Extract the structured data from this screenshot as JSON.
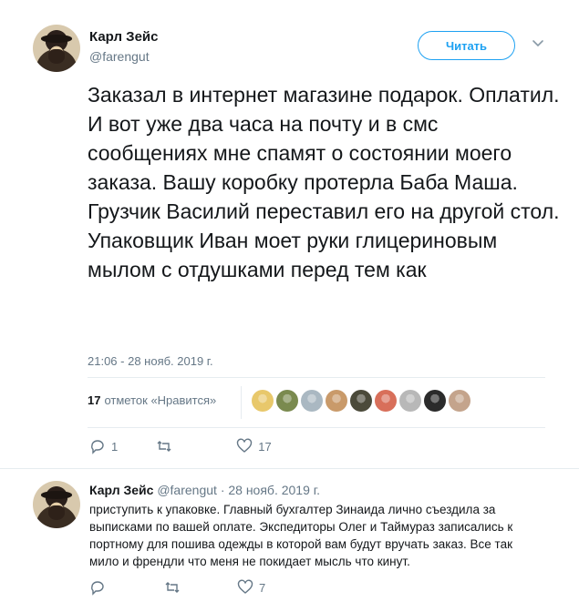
{
  "tweet": {
    "author_name": "Карл Зейс",
    "author_handle": "@farengut",
    "follow_label": "Читать",
    "text": "Заказал в интернет магазине подарок. Оплатил. И вот уже два часа на почту и в смс сообщениях мне спамят о состоянии моего заказа. Вашу коробку протерла Баба Маша. Грузчик Василий переставил его на другой стол. Упаковщик Иван моет руки глицериновым мылом с отдушками перед тем как",
    "timestamp": "21:06 - 28 нояб. 2019 г.",
    "likes_count": "17",
    "likes_label": "отметок «Нравится»",
    "reply_count": "1",
    "retweet_count": "",
    "like_count": "17"
  },
  "likers": [
    {
      "icon": "liker-avatar",
      "color": "#e8c86b"
    },
    {
      "icon": "liker-avatar",
      "color": "#7a8a4f"
    },
    {
      "icon": "liker-avatar",
      "color": "#aab8c2"
    },
    {
      "icon": "liker-avatar",
      "color": "#c99a6a"
    },
    {
      "icon": "liker-avatar",
      "color": "#4b4a3a"
    },
    {
      "icon": "liker-avatar",
      "color": "#d86f5a"
    },
    {
      "icon": "liker-avatar",
      "color": "#b8b8b8"
    },
    {
      "icon": "liker-avatar",
      "color": "#2b2b2b"
    },
    {
      "icon": "liker-avatar",
      "color": "#c4a48c"
    }
  ],
  "reply": {
    "author_name": "Карл Зейс",
    "author_handle": "@farengut",
    "date": "· 28 нояб. 2019 г.",
    "text": "приступить к упаковке. Главный бухгалтер Зинаида лично съездила за выписками по вашей оплате. Экспедиторы Олег и Таймураз записались к портному для пошива одежды в которой вам будут вручать заказ. Все так мило и френдли что меня не покидает мысль что кинут.",
    "reply_count": "",
    "retweet_count": "",
    "like_count": "7"
  },
  "colors": {
    "accent": "#1da1f2",
    "muted": "#657786",
    "divider": "#e6ecf0"
  }
}
